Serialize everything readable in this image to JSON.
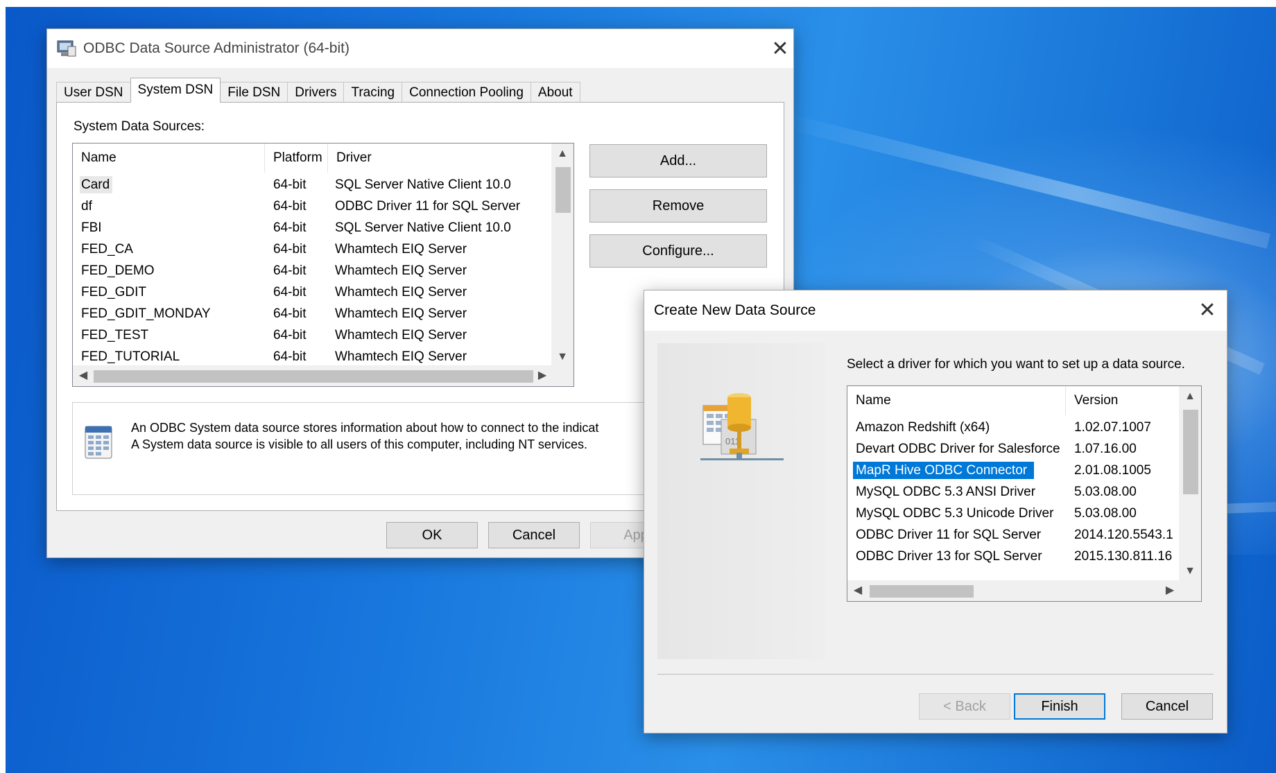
{
  "admin": {
    "title": "ODBC Data Source Administrator (64-bit)",
    "tabs": [
      "User DSN",
      "System DSN",
      "File DSN",
      "Drivers",
      "Tracing",
      "Connection Pooling",
      "About"
    ],
    "active_tab": "System DSN",
    "panel_label": "System Data Sources:",
    "columns": [
      "Name",
      "Platform",
      "Driver"
    ],
    "rows": [
      {
        "name": "Card",
        "platform": "64-bit",
        "driver": "SQL Server Native Client 10.0"
      },
      {
        "name": "df",
        "platform": "64-bit",
        "driver": "ODBC Driver 11 for SQL Server"
      },
      {
        "name": "FBI",
        "platform": "64-bit",
        "driver": "SQL Server Native Client 10.0"
      },
      {
        "name": "FED_CA",
        "platform": "64-bit",
        "driver": "Whamtech EIQ Server"
      },
      {
        "name": "FED_DEMO",
        "platform": "64-bit",
        "driver": "Whamtech EIQ Server"
      },
      {
        "name": "FED_GDIT",
        "platform": "64-bit",
        "driver": "Whamtech EIQ Server"
      },
      {
        "name": "FED_GDIT_MONDAY",
        "platform": "64-bit",
        "driver": "Whamtech EIQ Server"
      },
      {
        "name": "FED_TEST",
        "platform": "64-bit",
        "driver": "Whamtech EIQ Server"
      },
      {
        "name": "FED_TUTORIAL",
        "platform": "64-bit",
        "driver": "Whamtech EIQ Server"
      }
    ],
    "buttons": {
      "add": "Add...",
      "remove": "Remove",
      "configure": "Configure..."
    },
    "description_line1": "An ODBC System data source stores information about how to connect to the indicat",
    "description_line2": "A System data source is visible to all users of this computer, including NT services.",
    "footer": {
      "ok": "OK",
      "cancel": "Cancel",
      "apply": "App"
    }
  },
  "newds": {
    "title": "Create New Data Source",
    "prompt": "Select a driver for which you want to set up a data source.",
    "columns": [
      "Name",
      "Version"
    ],
    "rows": [
      {
        "name": "Amazon Redshift (x64)",
        "version": "1.02.07.1007"
      },
      {
        "name": "Devart ODBC Driver for Salesforce",
        "version": "1.07.16.00"
      },
      {
        "name": "MapR Hive ODBC Connector",
        "version": "2.01.08.1005"
      },
      {
        "name": "MySQL ODBC 5.3 ANSI Driver",
        "version": "5.03.08.00"
      },
      {
        "name": "MySQL ODBC 5.3 Unicode Driver",
        "version": "5.03.08.00"
      },
      {
        "name": "ODBC Driver 11 for SQL Server",
        "version": "2014.120.5543.1"
      },
      {
        "name": "ODBC Driver 13 for SQL Server",
        "version": "2015.130.811.16"
      }
    ],
    "selected_row": "MapR Hive ODBC Connector",
    "buttons": {
      "back": "< Back",
      "finish": "Finish",
      "cancel": "Cancel"
    }
  },
  "icons": {
    "close": "close-icon",
    "scroll_up": "chevron-up-icon",
    "scroll_down": "chevron-down-icon",
    "scroll_left": "chevron-left-icon",
    "scroll_right": "chevron-right-icon"
  },
  "colors": {
    "accent": "#0078d7",
    "window_bg": "#f0f0f0",
    "desktop": "#1877dd"
  }
}
